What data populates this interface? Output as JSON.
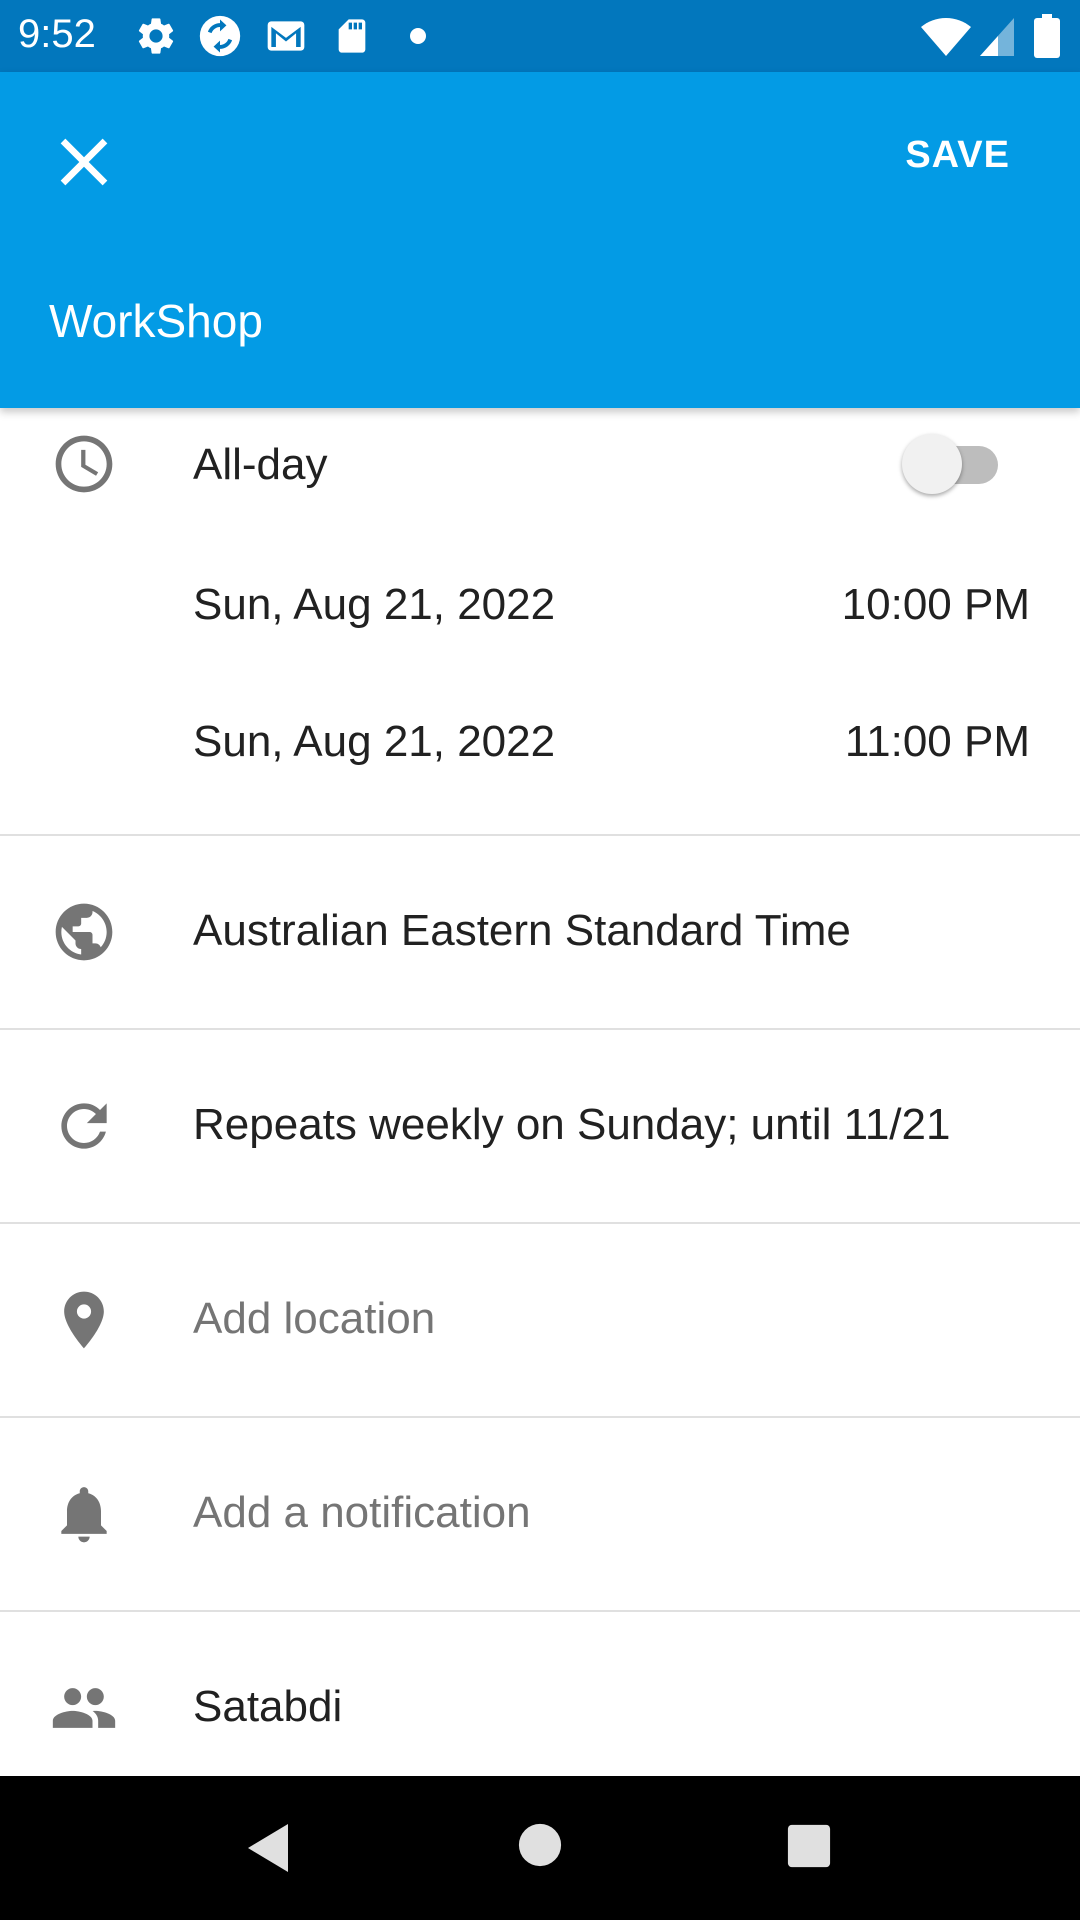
{
  "status_bar": {
    "time": "9:52",
    "left_icons": [
      "settings-icon",
      "sync-icon",
      "gmail-icon",
      "sd-card-icon",
      "dot-icon"
    ],
    "right_icons": [
      "wifi-icon",
      "cell-signal-icon",
      "battery-icon"
    ]
  },
  "app_bar": {
    "close_icon": "close-icon",
    "save_label": "SAVE",
    "title": "WorkShop",
    "background": "#039BE5"
  },
  "event": {
    "all_day_label": "All-day",
    "all_day_on": false,
    "start_date": "Sun, Aug 21, 2022",
    "start_time": "10:00 PM",
    "end_date": "Sun, Aug 21, 2022",
    "end_time": "11:00 PM",
    "timezone": "Australian Eastern Standard Time",
    "repeat": "Repeats weekly on Sunday; until 11/21",
    "location_placeholder": "Add location",
    "notification_placeholder": "Add a notification",
    "guest": "Satabdi"
  },
  "nav_bar": {
    "icons": [
      "back-icon",
      "home-icon",
      "recents-icon"
    ]
  }
}
